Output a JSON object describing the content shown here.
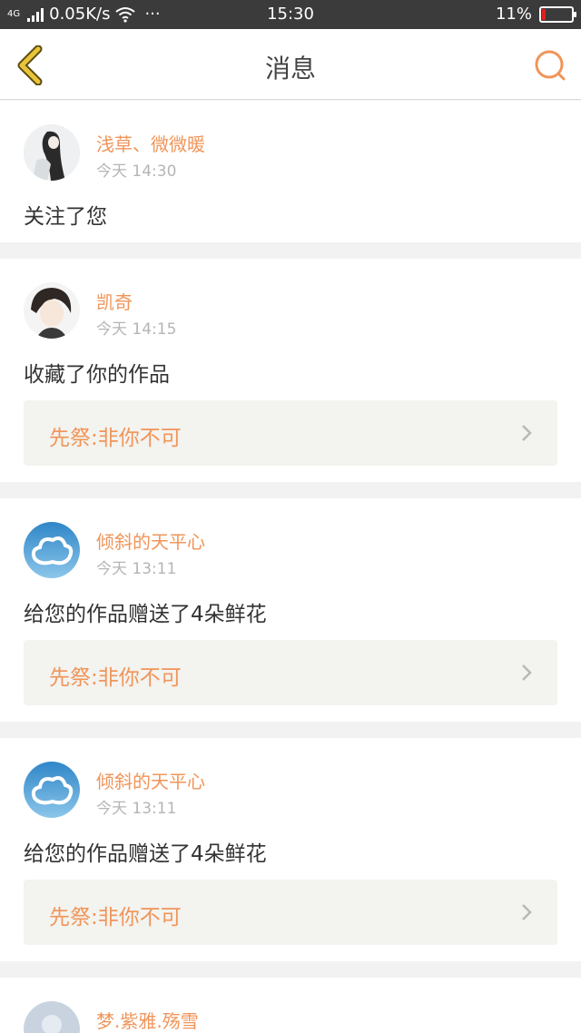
{
  "status_bar": {
    "network_type": "4G",
    "speed": "0.05K/s",
    "more": "···",
    "time": "15:30",
    "battery": "11%",
    "battery_level": 0.11,
    "icons": [
      "signal-icon",
      "wifi-icon",
      "battery-icon"
    ]
  },
  "header": {
    "title": "消息",
    "back_icon": "chevron-left-icon",
    "search_icon": "search-icon",
    "accent": "#f0955a",
    "back_color": "#e8c43a"
  },
  "messages": [
    {
      "user": "浅草、微微暖",
      "time": "今天 14:30",
      "action": "关注了您",
      "work": null,
      "avatar": "avatar-ink-girl"
    },
    {
      "user": "凯奇",
      "time": "今天 14:15",
      "action": "收藏了你的作品",
      "work": "先祭:非你不可",
      "avatar": "avatar-anime-boy"
    },
    {
      "user": "倾斜的天平心",
      "time": "今天 13:11",
      "action": "给您的作品赠送了4朵鲜花",
      "work": "先祭:非你不可",
      "avatar": "avatar-cloud"
    },
    {
      "user": "倾斜的天平心",
      "time": "今天 13:11",
      "action": "给您的作品赠送了4朵鲜花",
      "work": "先祭:非你不可",
      "avatar": "avatar-cloud"
    },
    {
      "user": "梦.紫雅.殇雪",
      "avatar": "avatar-default"
    }
  ]
}
